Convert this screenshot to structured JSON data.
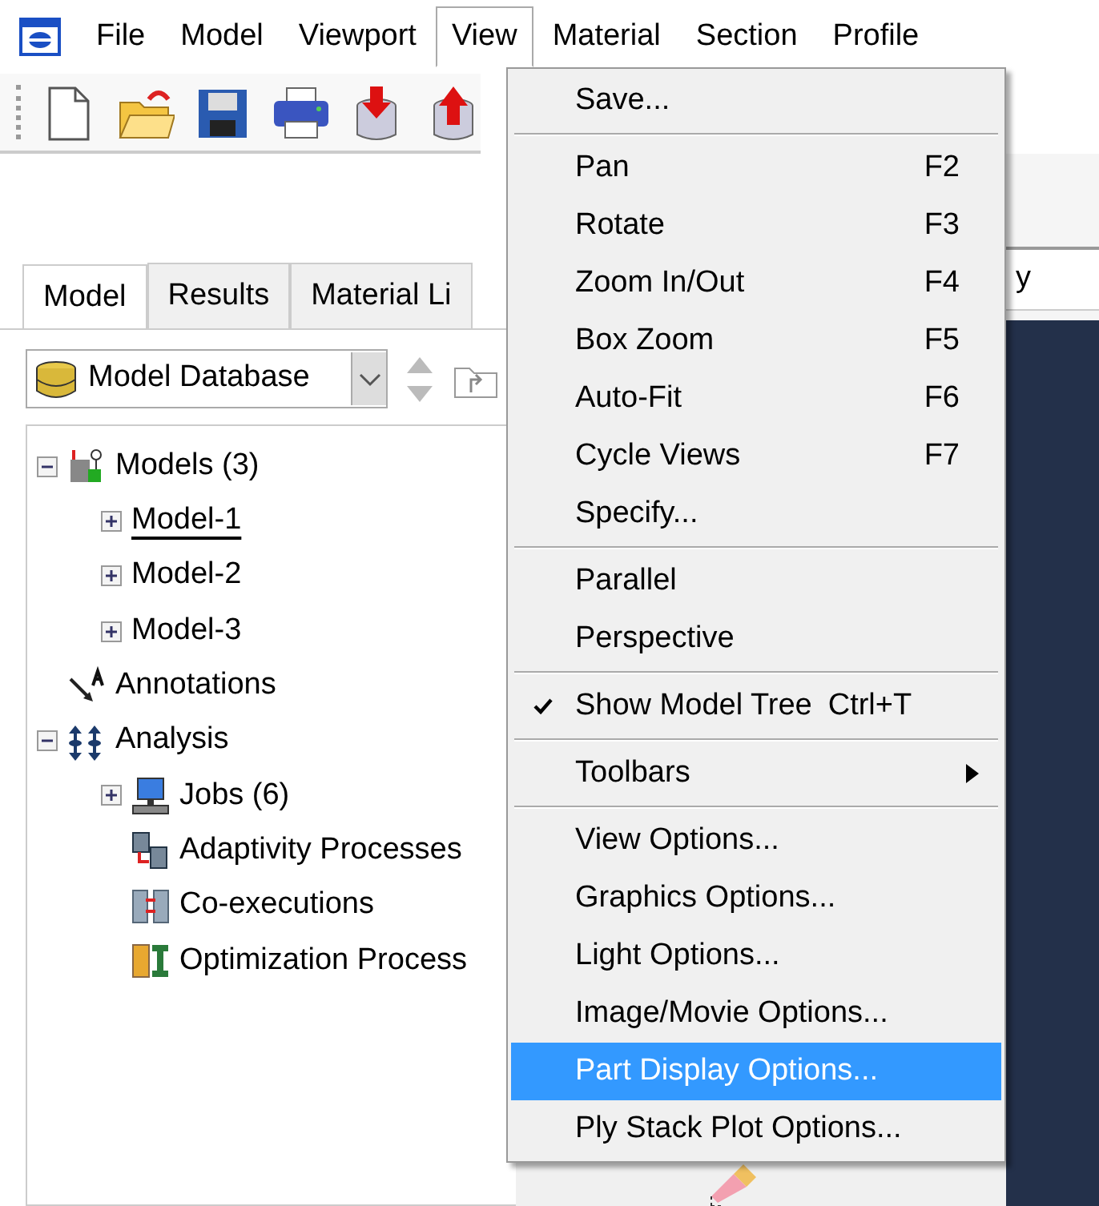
{
  "menubar": [
    {
      "label": "File",
      "open": false
    },
    {
      "label": "Model",
      "open": false
    },
    {
      "label": "Viewport",
      "open": false
    },
    {
      "label": "View",
      "open": true
    },
    {
      "label": "Material",
      "open": false
    },
    {
      "label": "Section",
      "open": false
    },
    {
      "label": "Profile",
      "open": false
    }
  ],
  "toolbar": [
    {
      "kind": "new"
    },
    {
      "kind": "open"
    },
    {
      "kind": "save"
    },
    {
      "kind": "print"
    },
    {
      "kind": "import"
    },
    {
      "kind": "export"
    }
  ],
  "tabs": [
    {
      "label": "Model",
      "selected": true
    },
    {
      "label": "Results",
      "selected": false
    },
    {
      "label": "Material Li",
      "selected": false
    }
  ],
  "database_select": {
    "value": "Model Database"
  },
  "tree": [
    {
      "label": "Models (3)",
      "kind": "models",
      "expanded": true,
      "children": [
        {
          "label": "Model-1",
          "kind": "model",
          "expanded": false,
          "current": true
        },
        {
          "label": "Model-2",
          "kind": "model",
          "expanded": false,
          "current": false
        },
        {
          "label": "Model-3",
          "kind": "model",
          "expanded": false,
          "current": false
        }
      ]
    },
    {
      "label": "Annotations",
      "kind": "annotations"
    },
    {
      "label": "Analysis",
      "kind": "analysis",
      "expanded": true,
      "children": [
        {
          "label": "Jobs (6)",
          "kind": "jobs",
          "expanded": false
        },
        {
          "label": "Adaptivity Processes",
          "kind": "adaptivity"
        },
        {
          "label": "Co-executions",
          "kind": "coexec"
        },
        {
          "label": "Optimization Process",
          "kind": "optimization"
        }
      ]
    }
  ],
  "viewport_field": {
    "value": "y"
  },
  "menu": [
    {
      "kind": "item",
      "label": "Save...",
      "selected": false
    },
    {
      "kind": "separator"
    },
    {
      "kind": "item",
      "label": "Pan",
      "shortcut": "F2",
      "selected": false
    },
    {
      "kind": "item",
      "label": "Rotate",
      "shortcut": "F3",
      "selected": false
    },
    {
      "kind": "item",
      "label": "Zoom In/Out",
      "shortcut": "F4",
      "selected": false
    },
    {
      "kind": "item",
      "label": "Box Zoom",
      "shortcut": "F5",
      "selected": false
    },
    {
      "kind": "item",
      "label": "Auto-Fit",
      "shortcut": "F6",
      "selected": false
    },
    {
      "kind": "item",
      "label": "Cycle Views",
      "shortcut": "F7",
      "selected": false
    },
    {
      "kind": "item",
      "label": "Specify...",
      "selected": false
    },
    {
      "kind": "separator"
    },
    {
      "kind": "item",
      "label": "Parallel",
      "selected": false
    },
    {
      "kind": "item",
      "label": "Perspective",
      "selected": false
    },
    {
      "kind": "separator"
    },
    {
      "kind": "check",
      "label": "Show Model Tree",
      "shortcut": "Ctrl+T",
      "checked": true,
      "selected": false
    },
    {
      "kind": "separator"
    },
    {
      "kind": "submenu",
      "label": "Toolbars",
      "selected": false
    },
    {
      "kind": "separator"
    },
    {
      "kind": "item",
      "label": "View Options...",
      "selected": false
    },
    {
      "kind": "item",
      "label": "Graphics Options...",
      "selected": false
    },
    {
      "kind": "item",
      "label": "Light Options...",
      "selected": false
    },
    {
      "kind": "item",
      "label": "Image/Movie Options...",
      "selected": false
    },
    {
      "kind": "item",
      "label": "Part Display Options...",
      "selected": true
    },
    {
      "kind": "item",
      "label": "Ply Stack Plot Options...",
      "selected": false
    }
  ]
}
